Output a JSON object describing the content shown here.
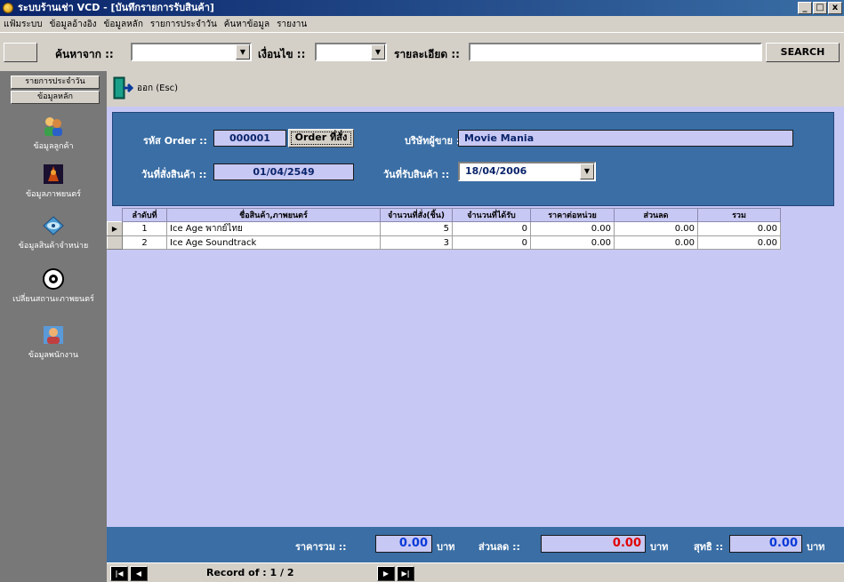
{
  "window": {
    "title": "ระบบร้านเช่า VCD - [บันทึกรายการรับสินค้า]",
    "buttons": [
      "_",
      "□",
      "x"
    ]
  },
  "menu": [
    "แฟ้มระบบ",
    "ข้อมูลอ้างอิง",
    "ข้อมูลหลัก",
    "รายการประจำวัน",
    "ค้นหาข้อมูล",
    "รายงาน"
  ],
  "search": {
    "from_label": "ค้นหาจาก ::",
    "condition_label": "เงื่อนไข ::",
    "detail_label": "รายละเอียด ::",
    "button": "SEARCH"
  },
  "sidebar": {
    "tabs": [
      "รายการประจำวัน",
      "ข้อมูลหลัก"
    ],
    "items": [
      {
        "label": "ข้อมูลลูกค้า",
        "icon": "customers-icon"
      },
      {
        "label": "ข้อมูลภาพยนตร์",
        "icon": "movie-icon"
      },
      {
        "label": "ข้อมูลสินค้าจำหน่าย",
        "icon": "disc-icon"
      },
      {
        "label": "เปลี่ยนสถานะภาพยนตร์",
        "icon": "cd-icon"
      },
      {
        "label": "ข้อมูลพนักงาน",
        "icon": "employee-icon"
      }
    ]
  },
  "exit": {
    "label": "ออก (Esc)"
  },
  "order": {
    "order_id_label": "รหัส Order ::",
    "order_id": "000001",
    "order_button": "Order ที่สั่ง",
    "supplier_label": "บริษัทผู้ขาย ::",
    "supplier": "Movie Mania",
    "order_date_label": "วันที่สั่งสินค้า ::",
    "order_date": "01/04/2549",
    "receive_date_label": "วันที่รับสินค้า ::",
    "receive_date": "18/04/2006"
  },
  "grid": {
    "columns": [
      "ลำดับที่",
      "ชื่อสินค้า,ภาพยนตร์",
      "จำนวนที่สั่ง(ชิ้น)",
      "จำนวนที่ได้รับ",
      "ราคาต่อหน่วย",
      "ส่วนลด",
      "รวม"
    ],
    "rows": [
      [
        "1",
        "Ice Age พากย์ไทย",
        "5",
        "0",
        "0.00",
        "0.00",
        "0.00"
      ],
      [
        "2",
        "Ice Age Soundtrack",
        "3",
        "0",
        "0.00",
        "0.00",
        "0.00"
      ]
    ]
  },
  "totals": {
    "total_label": "ราคารวม ::",
    "total": "0.00",
    "discount_label": "ส่วนลด ::",
    "discount": "0.00",
    "net_label": "สุทธิ ::",
    "net": "0.00",
    "currency": "บาท",
    "colors": {
      "total": "#0a3ad8",
      "discount": "#e00000",
      "net": "#0a3ad8"
    }
  },
  "nav": {
    "record_label": "Record of  :  1 / 2"
  }
}
